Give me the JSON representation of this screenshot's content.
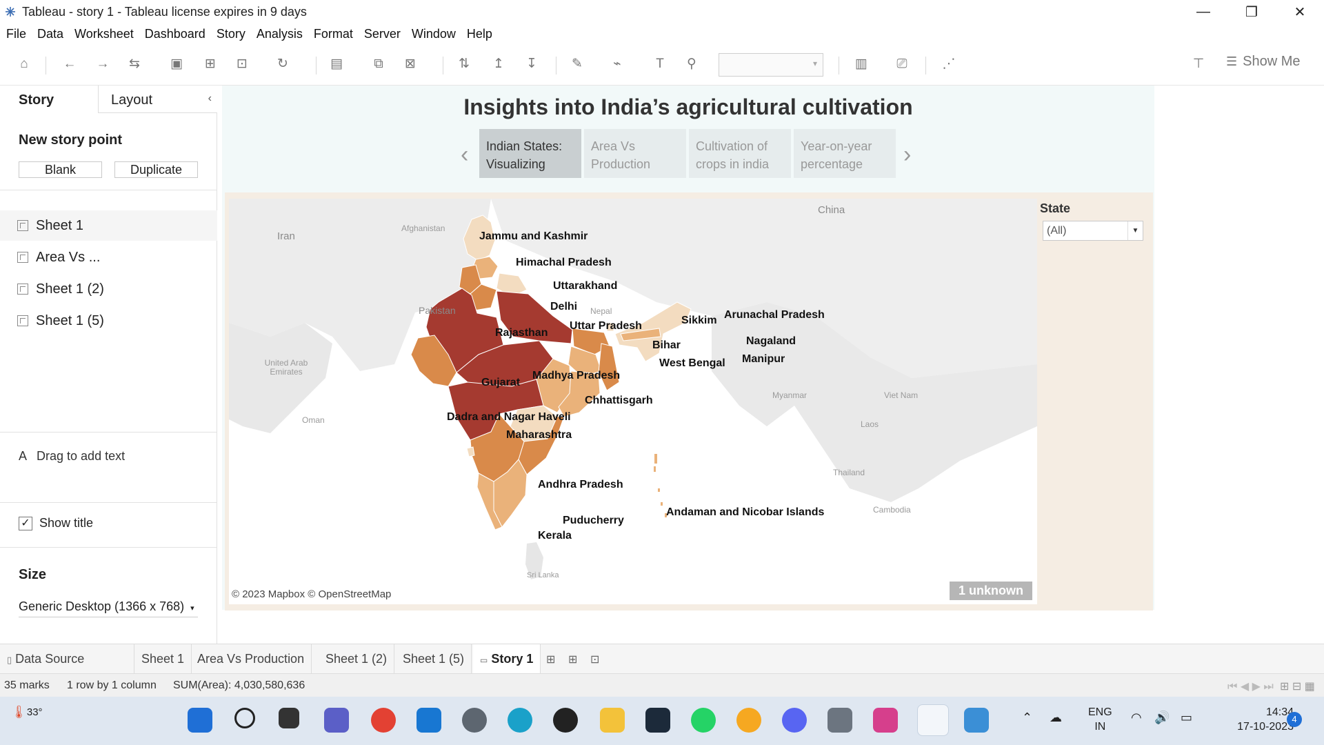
{
  "window": {
    "title": "Tableau - story 1 - Tableau license expires in 9 days"
  },
  "menu": [
    "File",
    "Data",
    "Worksheet",
    "Dashboard",
    "Story",
    "Analysis",
    "Format",
    "Server",
    "Window",
    "Help"
  ],
  "toolbar": {
    "show_me": "Show Me"
  },
  "left_panel": {
    "tab_story": "Story",
    "tab_layout": "Layout",
    "new_story_point": "New story point",
    "blank": "Blank",
    "duplicate": "Duplicate",
    "sheets": [
      "Sheet 1",
      "Area Vs ...",
      "Sheet 1 (2)",
      "Sheet 1 (5)"
    ],
    "drag_text": "Drag to add text",
    "drag_text_icon": "A",
    "show_title": "Show title",
    "size_label": "Size",
    "size_value": "Generic Desktop (1366 x 768)"
  },
  "story": {
    "title": "Insights into India’s agricultural cultivation",
    "points": [
      {
        "line1": "Indian States:",
        "line2": "Visualizing"
      },
      {
        "line1": "Area Vs",
        "line2": "Production"
      },
      {
        "line1": "Cultivation of",
        "line2": "crops in india"
      },
      {
        "line1": "Year-on-year",
        "line2": "percentage"
      }
    ]
  },
  "map": {
    "state_labels": [
      "Jammu and Kashmir",
      "Himachal Pradesh",
      "Uttarakhand",
      "Delhi",
      "Rajasthan",
      "Uttar Pradesh",
      "Sikkim",
      "Arunachal Pradesh",
      "Bihar",
      "Nagaland",
      "West Bengal",
      "Manipur",
      "Madhya Pradesh",
      "Gujarat",
      "Chhattisgarh",
      "Dadra and Nagar Haveli",
      "Maharashtra",
      "Andhra Pradesh",
      "Andaman and Nicobar Islands",
      "Puducherry",
      "Kerala"
    ],
    "geo_labels": [
      "China",
      "Afghanistan",
      "Iran",
      "Pakistan",
      "Nepal",
      "United Arab Emirates",
      "Oman",
      "Myanmar",
      "Viet Nam",
      "Laos",
      "Thailand",
      "Cambodia",
      "Sri Lanka"
    ],
    "attribution": "© 2023 Mapbox © OpenStreetMap",
    "unknown_badge": "1 unknown",
    "colors": {
      "dark": "#a53a30",
      "mid": "#d98a4a",
      "light": "#eab27a",
      "pale": "#f3dcc0"
    }
  },
  "filter": {
    "label": "State",
    "value": "(All)"
  },
  "sheet_tabs": {
    "data_source": "Data Source",
    "tabs": [
      "Sheet 1",
      "Area Vs Production",
      "Sheet 1 (2)",
      "Sheet 1 (5)"
    ],
    "active": "Story 1"
  },
  "status": {
    "marks": "35 marks",
    "rows": "1 row by 1 column",
    "sum": "SUM(Area): 4,030,580,636"
  },
  "taskbar": {
    "temp": "33°",
    "lang1": "ENG",
    "lang2": "IN",
    "time": "14:34",
    "date": "17-10-2023",
    "notif_count": "4"
  }
}
